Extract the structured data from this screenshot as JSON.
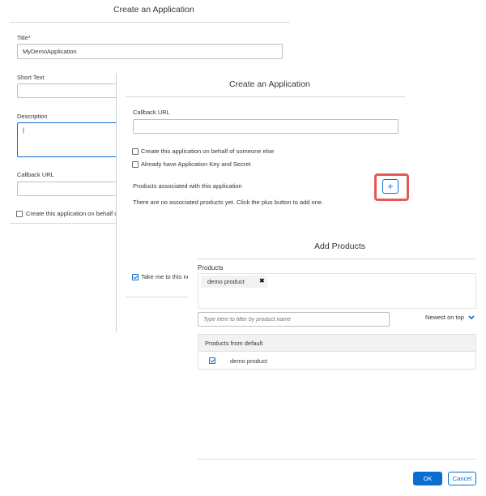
{
  "back_form": {
    "title": "Create an Application",
    "title_label": "Title",
    "title_required_mark": "*",
    "title_value": "MyDemoApplication",
    "short_text_label": "Short Text",
    "description_label": "Description",
    "description_value": "|",
    "callback_url_label": "Callback URL",
    "on_behalf_checkbox_label": "Create this application on behalf o"
  },
  "mid_form": {
    "title": "Create an Application",
    "callback_url_label": "Callback URL",
    "callback_url_value": "",
    "on_behalf_checkbox_label": "Create this application on behalf of someone else",
    "have_key_checkbox_label": "Already have Application Key and Secret",
    "products_label": "Products associated with this application",
    "add_product_symbol": "+",
    "no_products_message": "There are no associated products yet. Click the plus button to add one.",
    "take_me_label": "Take me to this ne"
  },
  "add_products_dialog": {
    "title": "Add Products",
    "products_label": "Products",
    "selected_tokens": [
      {
        "label": "demo product",
        "remove_symbol": "✖"
      }
    ],
    "filter_placeholder": "Type here to filter by product name",
    "sort_label": "Newest on top",
    "group_header": "Products from default",
    "items": [
      {
        "label": "demo product",
        "checked": true
      }
    ],
    "ok_label": "OK",
    "cancel_label": "Cancel"
  },
  "colors": {
    "accent": "#0a6ed1",
    "highlight_border": "#e05a5a",
    "required": "#bb0000"
  }
}
